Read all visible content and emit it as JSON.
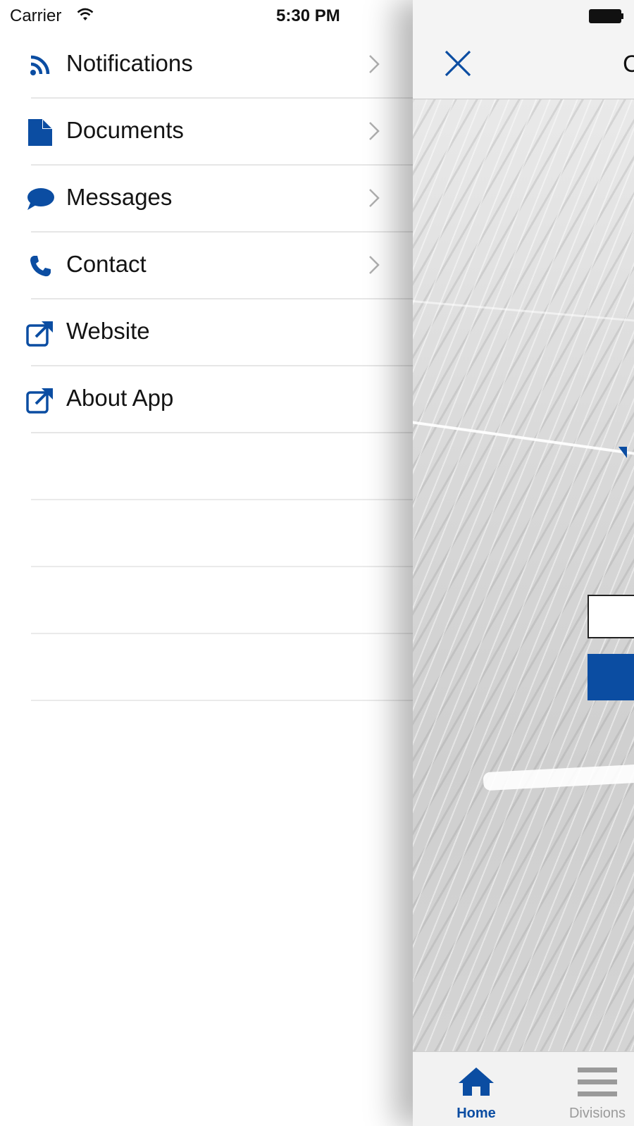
{
  "status_bar": {
    "carrier": "Carrier",
    "time": "5:30 PM"
  },
  "menu": {
    "items": [
      {
        "label": "Notifications",
        "icon": "rss-icon",
        "has_chevron": true
      },
      {
        "label": "Documents",
        "icon": "document-icon",
        "has_chevron": true
      },
      {
        "label": "Messages",
        "icon": "chat-bubble-icon",
        "has_chevron": true
      },
      {
        "label": "Contact",
        "icon": "phone-icon",
        "has_chevron": true
      },
      {
        "label": "Website",
        "icon": "external-link-icon",
        "has_chevron": false
      },
      {
        "label": "About App",
        "icon": "external-link-icon",
        "has_chevron": false
      }
    ]
  },
  "main": {
    "title_fragment": "C",
    "tabs": [
      {
        "label": "Home",
        "icon": "home-icon",
        "selected": true
      },
      {
        "label": "Divisions",
        "icon": "list-icon",
        "selected": false
      }
    ]
  },
  "colors": {
    "accent": "#0b4da2",
    "divider": "#e6e6e6",
    "text": "#141414",
    "inactive_tab": "#9a9a9a"
  }
}
